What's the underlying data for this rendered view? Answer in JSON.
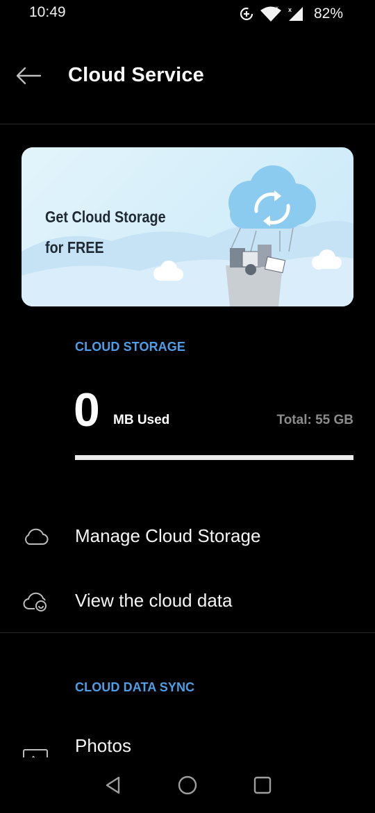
{
  "status_bar": {
    "time": "10:49",
    "battery": "82%",
    "icons": [
      "data-saver-icon",
      "wifi-icon",
      "signal-icon",
      "battery-icon"
    ]
  },
  "app_bar": {
    "title": "Cloud Service",
    "back_icon": "arrow-left-icon"
  },
  "promo": {
    "line1": "Get Cloud Storage",
    "line2": "for FREE",
    "art": "cloud-sync-balloon-illustration"
  },
  "cloud_storage": {
    "header": "CLOUD STORAGE",
    "used_value": "0",
    "used_unit": "MB Used",
    "total": "Total: 55 GB",
    "used_fraction": 0
  },
  "menu": [
    {
      "label": "Manage Cloud Storage",
      "icon": "cloud-icon"
    },
    {
      "label": "View the cloud data",
      "icon": "cloud-view-icon"
    }
  ],
  "cloud_data_sync": {
    "header": "CLOUD DATA SYNC",
    "items": [
      {
        "label": "Photos",
        "icon": "photo-icon"
      }
    ]
  },
  "nav_bar": {
    "buttons": [
      "back-triangle-icon",
      "home-circle-icon",
      "recents-square-icon"
    ]
  },
  "colors": {
    "background": "#000000",
    "accent": "#4f9ee8",
    "muted_text": "#8c8c8c",
    "bar": "#ececec"
  }
}
